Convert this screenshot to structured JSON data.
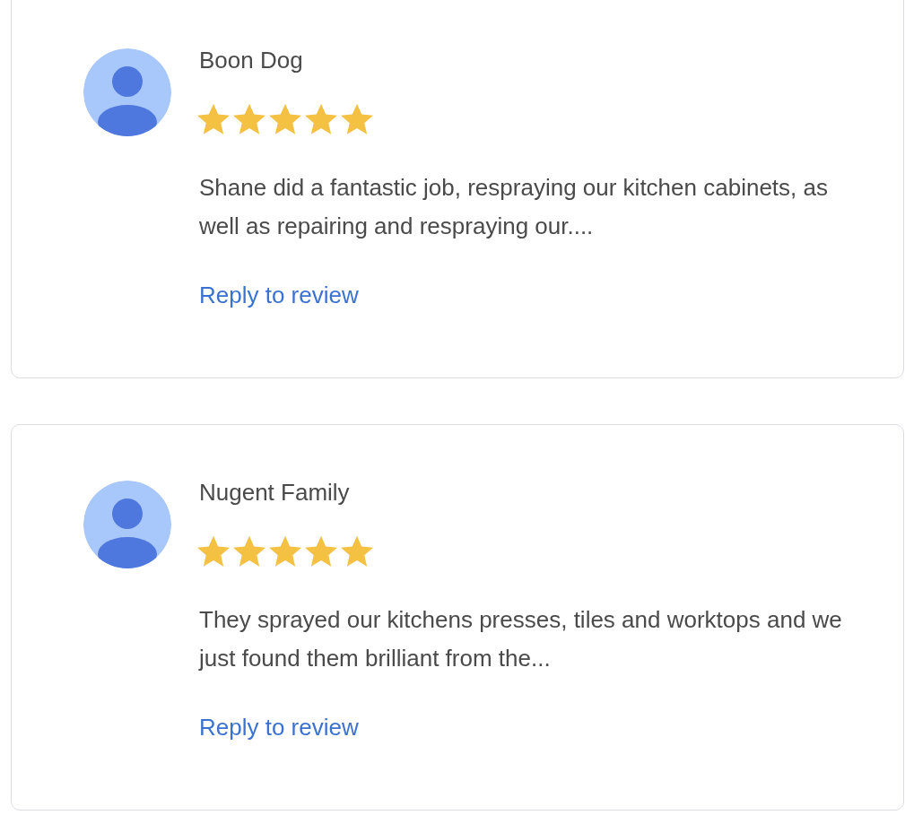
{
  "reviews": [
    {
      "name": "Boon Dog",
      "stars": 5,
      "text": "Shane did a fantastic job, respraying our kitchen cabinets, as well as repairing and respraying our....",
      "reply_link": "Reply to review"
    },
    {
      "name": "Nugent Family",
      "stars": 5,
      "text": "They sprayed our kitchens presses, tiles and worktops and we just found them brilliant from the...",
      "reply_link": "Reply to review"
    }
  ]
}
